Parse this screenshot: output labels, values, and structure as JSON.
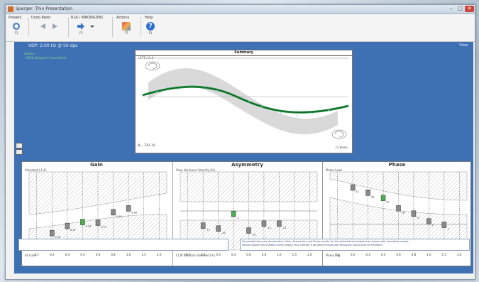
{
  "window": {
    "title": "Sperger: Thin Presentation",
    "min_glyph": "–",
    "max_glyph": "□",
    "close_glyph": "✕"
  },
  "toolbar": {
    "groups": [
      {
        "label": "Presets",
        "buttons": [
          {
            "icon": "magnifier-icon",
            "caption": "F1"
          }
        ]
      },
      {
        "label": "Undo   Redo",
        "buttons": [
          {
            "icon": "undo-icon",
            "caption": ""
          },
          {
            "icon": "redo-icon",
            "caption": ""
          }
        ]
      },
      {
        "label": "RLA / WRONGDBS",
        "buttons": [
          {
            "icon": "arrow-right-icon",
            "caption": "F5"
          },
          {
            "icon": "dropdown-icon",
            "caption": ""
          }
        ]
      },
      {
        "label": "Actions",
        "buttons": [
          {
            "icon": "tools-icon",
            "caption": "F7"
          }
        ]
      },
      {
        "label": "Help",
        "buttons": [
          {
            "icon": "help-icon",
            "caption": "F1"
          }
        ]
      }
    ]
  },
  "header": {
    "vdp": "VDP: 2.00 Hz @ 50 dps",
    "view": "View",
    "legend_line1": "Subject",
    "legend_line2": "- 100% Dirigentis Form Series"
  },
  "summary": {
    "title": "Summary",
    "top_left": "LEFT / 0.4",
    "bottom_left": "N= 720-10",
    "bottom_right": "15 Beats"
  },
  "gain": {
    "title": "Gain",
    "label_top": "Standard (-1.4)",
    "label_bottom": "All Gain",
    "x_ticks": [
      "0.1",
      "0.2",
      "0.3",
      "0.4",
      "0.6",
      "0.8",
      "1.0",
      "1.5",
      "2.0"
    ],
    "points": [
      {
        "freq": "0.1",
        "value": 0.12,
        "label": "0.12",
        "highlight": false
      },
      {
        "freq": "0.2",
        "value": 0.26,
        "label": "0.26",
        "highlight": false
      },
      {
        "freq": "0.3",
        "value": 0.37,
        "label": "0.37",
        "highlight": false
      },
      {
        "freq": "0.4",
        "value": 0.43,
        "label": "0.43",
        "highlight": true
      },
      {
        "freq": "0.6",
        "value": 0.42,
        "label": "0.42",
        "highlight": false
      },
      {
        "freq": "0.8",
        "value": 0.58,
        "label": "0.58",
        "highlight": false
      },
      {
        "freq": "1.0",
        "value": 0.64,
        "label": "0.64",
        "highlight": false
      }
    ]
  },
  "asymmetry": {
    "title": "Asymmetry",
    "label_top": "Slow Harmonic Velocity (%)",
    "label_bottom": "CCW Rotation Intended (%)",
    "x_ticks": [
      "0.1",
      "0.2",
      "0.3",
      "0.4",
      "0.6",
      "0.8",
      "1.0",
      "1.5",
      "2.0"
    ],
    "points": [
      {
        "freq": "0.2",
        "value": -15,
        "label": "-15",
        "highlight": false
      },
      {
        "freq": "0.3",
        "value": -18,
        "label": "-18",
        "highlight": false
      },
      {
        "freq": "0.4",
        "value": -3,
        "label": "-3",
        "highlight": true
      },
      {
        "freq": "0.6",
        "value": -20,
        "label": "-20",
        "highlight": false
      },
      {
        "freq": "0.8",
        "value": -13,
        "label": "-13",
        "highlight": false
      },
      {
        "freq": "1.0",
        "value": -13,
        "label": "-13",
        "highlight": false
      }
    ]
  },
  "phase": {
    "title": "Phase",
    "label_top": "Phase Lead",
    "label_bottom": "Phase Lag",
    "x_ticks": [
      "0.1",
      "0.2",
      "0.3",
      "0.4",
      "0.6",
      "0.8",
      "1.0",
      "1.5",
      "2.0"
    ],
    "points": [
      {
        "freq": "0.2",
        "value": 42,
        "label": "42",
        "highlight": false
      },
      {
        "freq": "0.3",
        "value": 36,
        "label": "36",
        "highlight": false
      },
      {
        "freq": "0.4",
        "value": 30,
        "label": "30",
        "highlight": true
      },
      {
        "freq": "0.6",
        "value": 18,
        "label": "18",
        "highlight": false
      },
      {
        "freq": "0.8",
        "value": 12,
        "label": "12",
        "highlight": false
      },
      {
        "freq": "1.0",
        "value": 3,
        "label": "3",
        "highlight": false
      },
      {
        "freq": "1.5",
        "value": -1,
        "label": "-1",
        "highlight": false
      }
    ]
  },
  "status": {
    "left": "",
    "right_line1": "Sinusoidal Harmonic Acceleration: Gain, Asymmetry and Phase results for the selected test frequencies shown with normative ranges",
    "right_line2": "Values outside the shaded normal region may indicate a peripheral vestibular weakness and should be reviewed"
  },
  "colors": {
    "accent": "#3e70b4",
    "highlight": "#4caf50",
    "marker": "#8a8a8a",
    "hatch": "#b9b9b9"
  }
}
